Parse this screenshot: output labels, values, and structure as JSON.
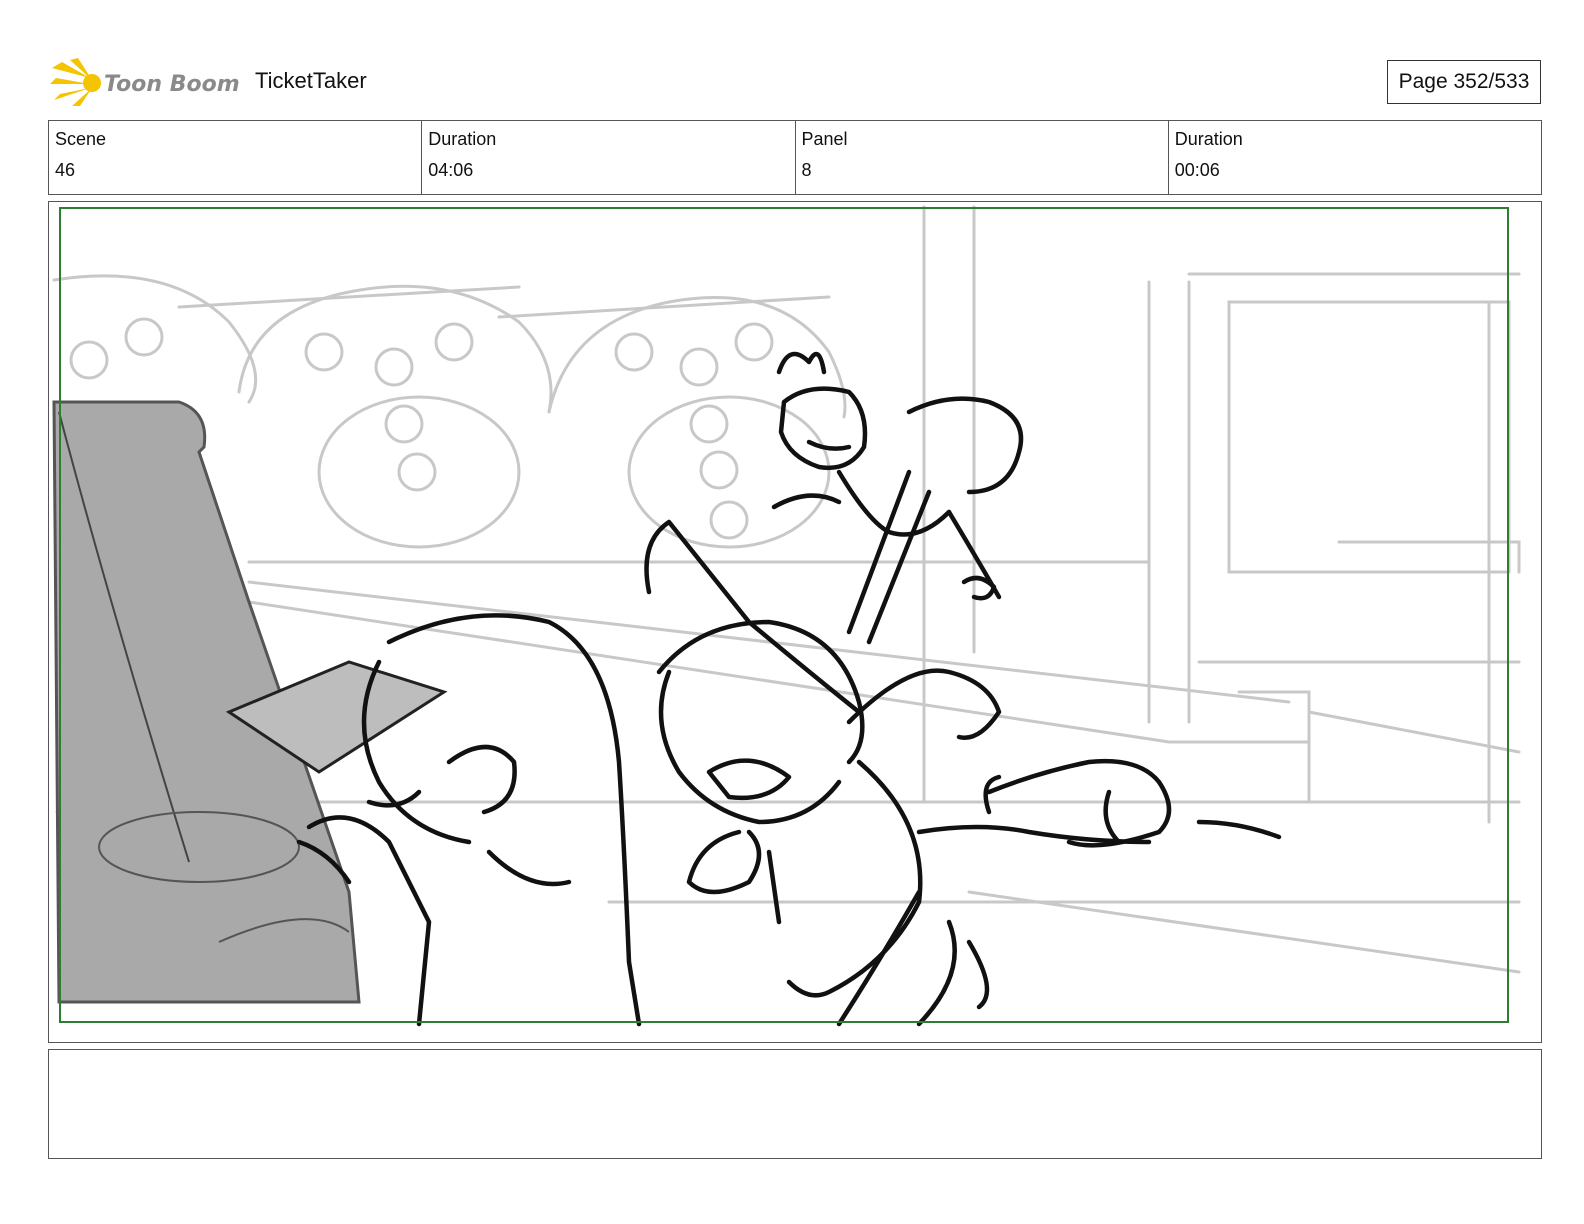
{
  "header": {
    "logo_text": "Toon Boom",
    "project_name": "TicketTaker",
    "page_label": "Page 352/533"
  },
  "info": {
    "scene_label": "Scene",
    "scene_value": "46",
    "scene_duration_label": "Duration",
    "scene_duration_value": "04:06",
    "panel_label": "Panel",
    "panel_value": "8",
    "panel_duration_label": "Duration",
    "panel_duration_value": "00:06"
  },
  "colors": {
    "safe_frame": "#2e7d32",
    "sketch_line": "#111111",
    "background_line": "#c8c8c8",
    "machine_fill": "#a9a9a9",
    "logo_accent": "#f5c400"
  },
  "notes": {
    "text": ""
  }
}
